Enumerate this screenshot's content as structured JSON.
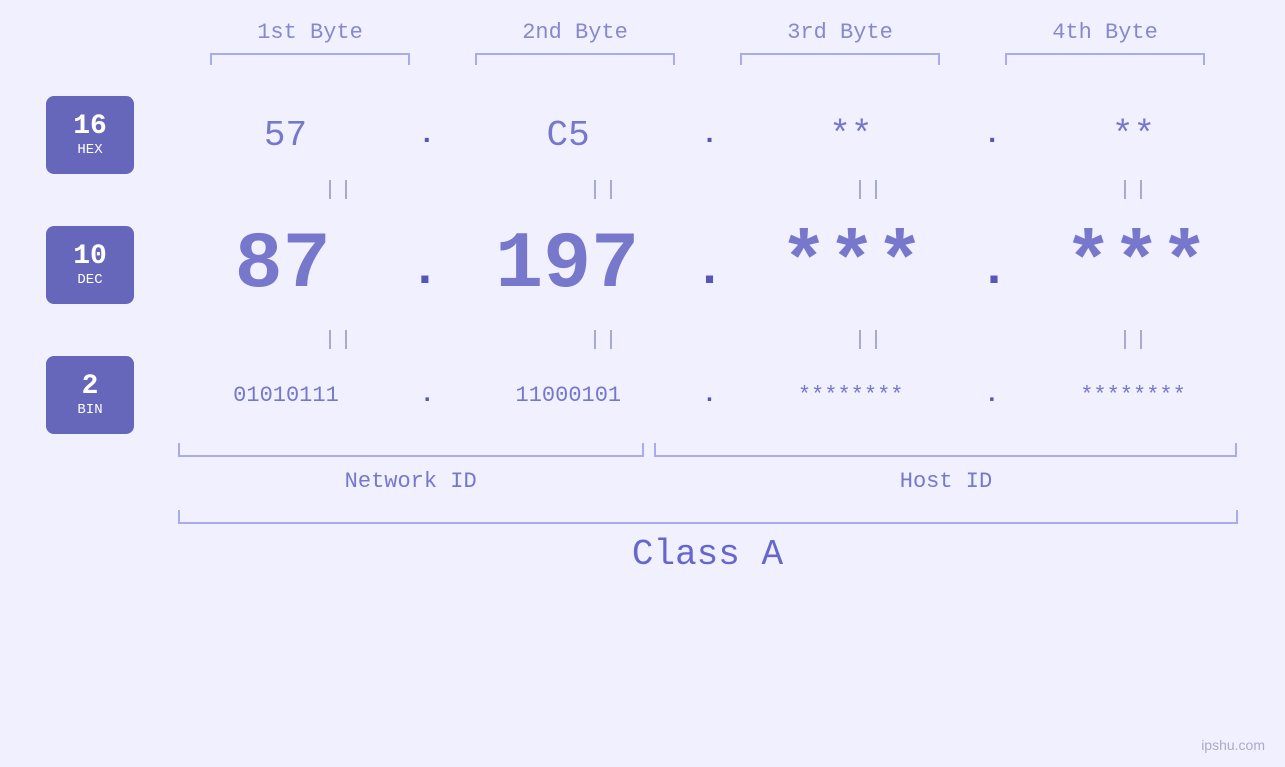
{
  "byteHeaders": [
    "1st Byte",
    "2nd Byte",
    "3rd Byte",
    "4th Byte"
  ],
  "hexBadge": {
    "number": "16",
    "label": "HEX"
  },
  "decBadge": {
    "number": "10",
    "label": "DEC"
  },
  "binBadge": {
    "number": "2",
    "label": "BIN"
  },
  "hexValues": [
    "57",
    "C5",
    "**",
    "**"
  ],
  "decValues": [
    "87",
    "197",
    "***",
    "***"
  ],
  "binValues": [
    "01010111",
    "11000101",
    "********",
    "********"
  ],
  "dotSeparator": ".",
  "equalsSign": "||",
  "networkIdLabel": "Network ID",
  "hostIdLabel": "Host ID",
  "classLabel": "Class A",
  "watermark": "ipshu.com"
}
